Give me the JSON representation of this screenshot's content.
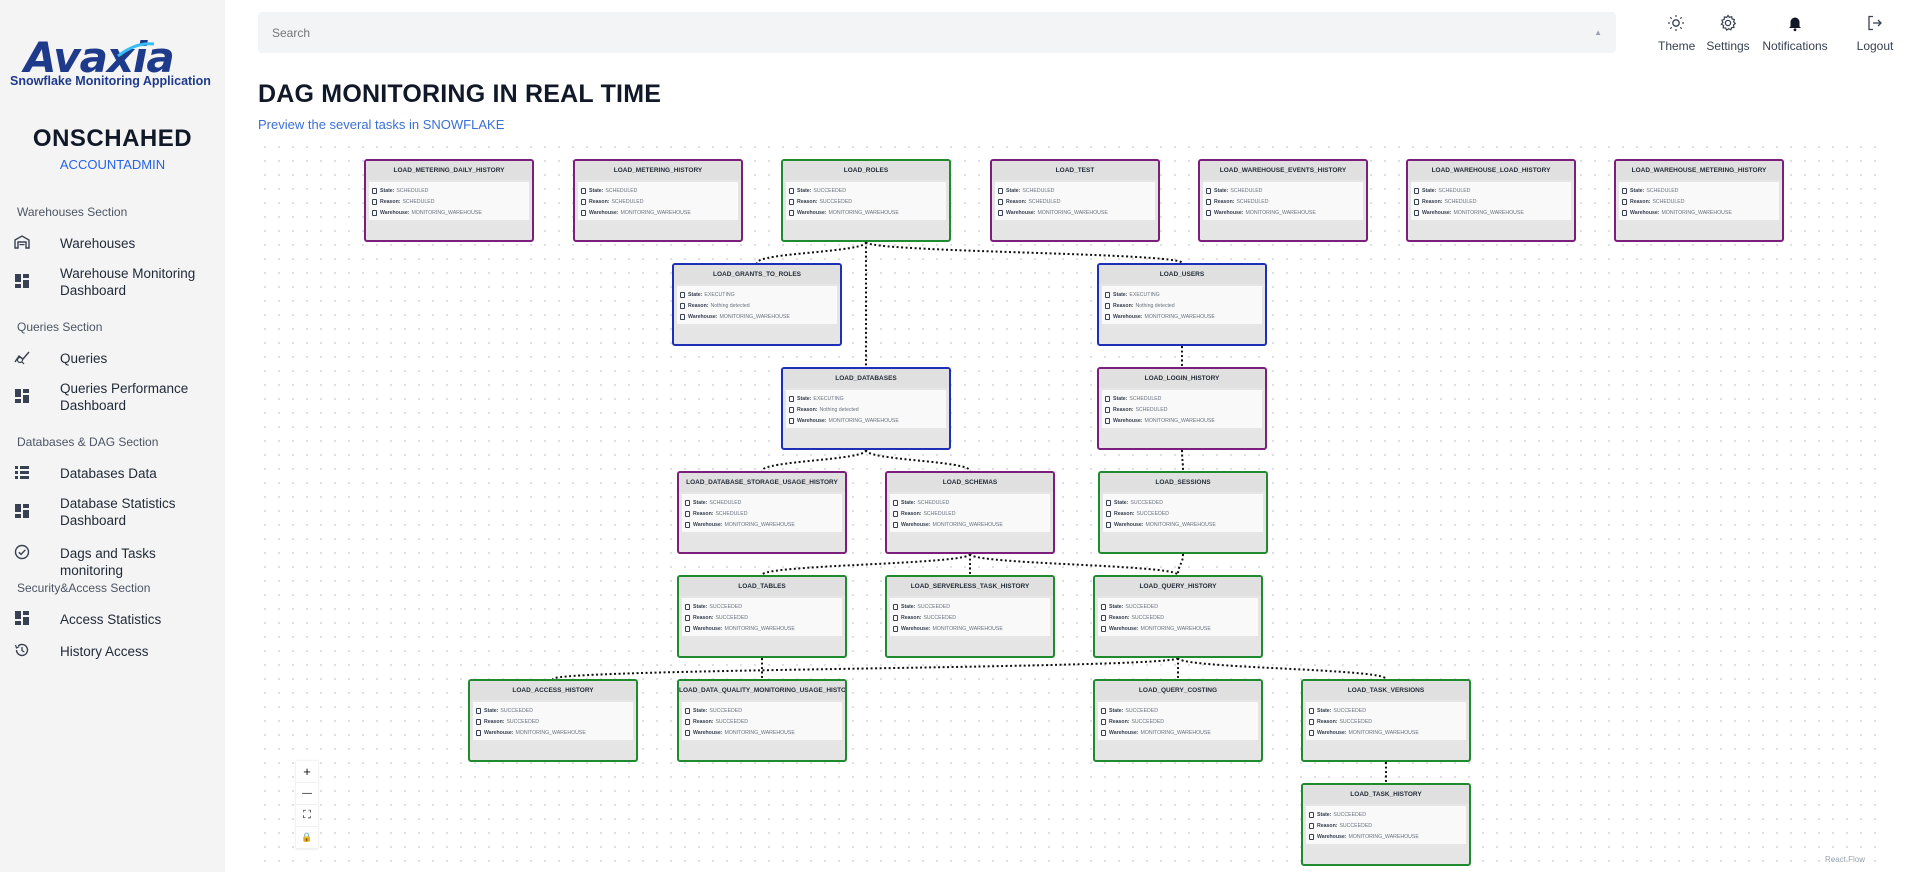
{
  "sidebar": {
    "logo_text": "Avaxia",
    "logo_subtitle": "Snowflake Monitoring Application",
    "account_name": "ONSCHAHED",
    "account_role": "ACCOUNTADMIN",
    "sections": [
      {
        "title": "Warehouses Section"
      },
      {
        "title": "Queries Section"
      },
      {
        "title": "Databases & DAG Section"
      },
      {
        "title": "Security&Access Section"
      }
    ],
    "items": [
      {
        "label": "Warehouses",
        "icon": "warehouse-icon"
      },
      {
        "label": "Warehouse Monitoring Dashboard",
        "icon": "dashboard-icon"
      },
      {
        "label": "Queries",
        "icon": "query-stats-icon"
      },
      {
        "label": "Queries Performance Dashboard",
        "icon": "dashboard-icon"
      },
      {
        "label": "Databases Data",
        "icon": "list-icon"
      },
      {
        "label": "Database Statistics Dashboard",
        "icon": "dashboard-icon"
      },
      {
        "label": "Dags and Tasks monitoring",
        "icon": "check-circle-icon"
      },
      {
        "label": "Access Statistics",
        "icon": "dashboard-icon"
      },
      {
        "label": "History Access",
        "icon": "history-icon"
      }
    ]
  },
  "header": {
    "search_placeholder": "Search",
    "actions": [
      {
        "label": "Theme",
        "icon": "sun-icon"
      },
      {
        "label": "Settings",
        "icon": "gear-icon"
      },
      {
        "label": "Notifications",
        "icon": "bell-icon"
      },
      {
        "label": "Logout",
        "icon": "logout-icon"
      }
    ]
  },
  "page": {
    "title": "DAG MONITORING IN REAL TIME",
    "subtitle": "Preview the several tasks in SNOWFLAKE"
  },
  "labels": {
    "state": "State:",
    "reason": "Reason:",
    "warehouse": "Warehouse:"
  },
  "status_colors": {
    "SCHEDULED": "#7c1f7c",
    "SUCCEEDED": "#1f8a2e",
    "EXECUTING": "#1e2fb8"
  },
  "nodes": [
    {
      "id": "LOAD_METERING_DAILY_HISTORY",
      "state": "SCHEDULED",
      "reason": "SCHEDULED",
      "warehouse": "MONITORING_WAREHOUSE"
    },
    {
      "id": "LOAD_METERING_HISTORY",
      "state": "SCHEDULED",
      "reason": "SCHEDULED",
      "warehouse": "MONITORING_WAREHOUSE"
    },
    {
      "id": "LOAD_ROLES",
      "state": "SUCCEEDED",
      "reason": "SUCCEEDED",
      "warehouse": "MONITORING_WAREHOUSE"
    },
    {
      "id": "LOAD_TEST",
      "state": "SCHEDULED",
      "reason": "SCHEDULED",
      "warehouse": "MONITORING_WAREHOUSE"
    },
    {
      "id": "LOAD_WAREHOUSE_EVENTS_HISTORY",
      "state": "SCHEDULED",
      "reason": "SCHEDULED",
      "warehouse": "MONITORING_WAREHOUSE"
    },
    {
      "id": "LOAD_WAREHOUSE_LOAD_HISTORY",
      "state": "SCHEDULED",
      "reason": "SCHEDULED",
      "warehouse": "MONITORING_WAREHOUSE"
    },
    {
      "id": "LOAD_WAREHOUSE_METERING_HISTORY",
      "state": "SCHEDULED",
      "reason": "SCHEDULED",
      "warehouse": "MONITORING_WAREHOUSE"
    },
    {
      "id": "LOAD_GRANTS_TO_ROLES",
      "state": "EXECUTING",
      "reason": "Nothing detected",
      "warehouse": "MONITORING_WAREHOUSE"
    },
    {
      "id": "LOAD_USERS",
      "state": "EXECUTING",
      "reason": "Nothing detected",
      "warehouse": "MONITORING_WAREHOUSE"
    },
    {
      "id": "LOAD_DATABASES",
      "state": "EXECUTING",
      "reason": "Nothing detected",
      "warehouse": "MONITORING_WAREHOUSE"
    },
    {
      "id": "LOAD_LOGIN_HISTORY",
      "state": "SCHEDULED",
      "reason": "SCHEDULED",
      "warehouse": "MONITORING_WAREHOUSE"
    },
    {
      "id": "LOAD_DATABASE_STORAGE_USAGE_HISTORY",
      "state": "SCHEDULED",
      "reason": "SCHEDULED",
      "warehouse": "MONITORING_WAREHOUSE"
    },
    {
      "id": "LOAD_SCHEMAS",
      "state": "SCHEDULED",
      "reason": "SCHEDULED",
      "warehouse": "MONITORING_WAREHOUSE"
    },
    {
      "id": "LOAD_SESSIONS",
      "state": "SUCCEEDED",
      "reason": "SUCCEEDED",
      "warehouse": "MONITORING_WAREHOUSE"
    },
    {
      "id": "LOAD_TABLES",
      "state": "SUCCEEDED",
      "reason": "SUCCEEDED",
      "warehouse": "MONITORING_WAREHOUSE"
    },
    {
      "id": "LOAD_SERVERLESS_TASK_HISTORY",
      "state": "SUCCEEDED",
      "reason": "SUCCEEDED",
      "warehouse": "MONITORING_WAREHOUSE"
    },
    {
      "id": "LOAD_QUERY_HISTORY",
      "state": "SUCCEEDED",
      "reason": "SUCCEEDED",
      "warehouse": "MONITORING_WAREHOUSE"
    },
    {
      "id": "LOAD_ACCESS_HISTORY",
      "state": "SUCCEEDED",
      "reason": "SUCCEEDED",
      "warehouse": "MONITORING_WAREHOUSE"
    },
    {
      "id": "LOAD_DATA_QUALITY_MONITORING_USAGE_HISTORY",
      "state": "SUCCEEDED",
      "reason": "SUCCEEDED",
      "warehouse": "MONITORING_WAREHOUSE"
    },
    {
      "id": "LOAD_QUERY_COSTING",
      "state": "SUCCEEDED",
      "reason": "SUCCEEDED",
      "warehouse": "MONITORING_WAREHOUSE"
    },
    {
      "id": "LOAD_TASK_VERSIONS",
      "state": "SUCCEEDED",
      "reason": "SUCCEEDED",
      "warehouse": "MONITORING_WAREHOUSE"
    },
    {
      "id": "LOAD_TASK_HISTORY",
      "state": "SUCCEEDED",
      "reason": "SUCCEEDED",
      "warehouse": "MONITORING_WAREHOUSE"
    }
  ],
  "edges": [
    [
      "LOAD_ROLES",
      "LOAD_GRANTS_TO_ROLES"
    ],
    [
      "LOAD_ROLES",
      "LOAD_USERS"
    ],
    [
      "LOAD_ROLES",
      "LOAD_DATABASES"
    ],
    [
      "LOAD_USERS",
      "LOAD_LOGIN_HISTORY"
    ],
    [
      "LOAD_DATABASES",
      "LOAD_DATABASE_STORAGE_USAGE_HISTORY"
    ],
    [
      "LOAD_DATABASES",
      "LOAD_SCHEMAS"
    ],
    [
      "LOAD_LOGIN_HISTORY",
      "LOAD_SESSIONS"
    ],
    [
      "LOAD_SCHEMAS",
      "LOAD_TABLES"
    ],
    [
      "LOAD_SCHEMAS",
      "LOAD_SERVERLESS_TASK_HISTORY"
    ],
    [
      "LOAD_SCHEMAS",
      "LOAD_QUERY_HISTORY"
    ],
    [
      "LOAD_SESSIONS",
      "LOAD_QUERY_HISTORY"
    ],
    [
      "LOAD_TABLES",
      "LOAD_DATA_QUALITY_MONITORING_USAGE_HISTORY"
    ],
    [
      "LOAD_QUERY_HISTORY",
      "LOAD_ACCESS_HISTORY"
    ],
    [
      "LOAD_QUERY_HISTORY",
      "LOAD_QUERY_COSTING"
    ],
    [
      "LOAD_QUERY_HISTORY",
      "LOAD_TASK_VERSIONS"
    ],
    [
      "LOAD_TASK_VERSIONS",
      "LOAD_TASK_HISTORY"
    ]
  ],
  "controls": {
    "zoom_in": "+",
    "zoom_out": "—",
    "fit_view": "⛶",
    "lock": "🔒"
  },
  "attribution": "React Flow"
}
